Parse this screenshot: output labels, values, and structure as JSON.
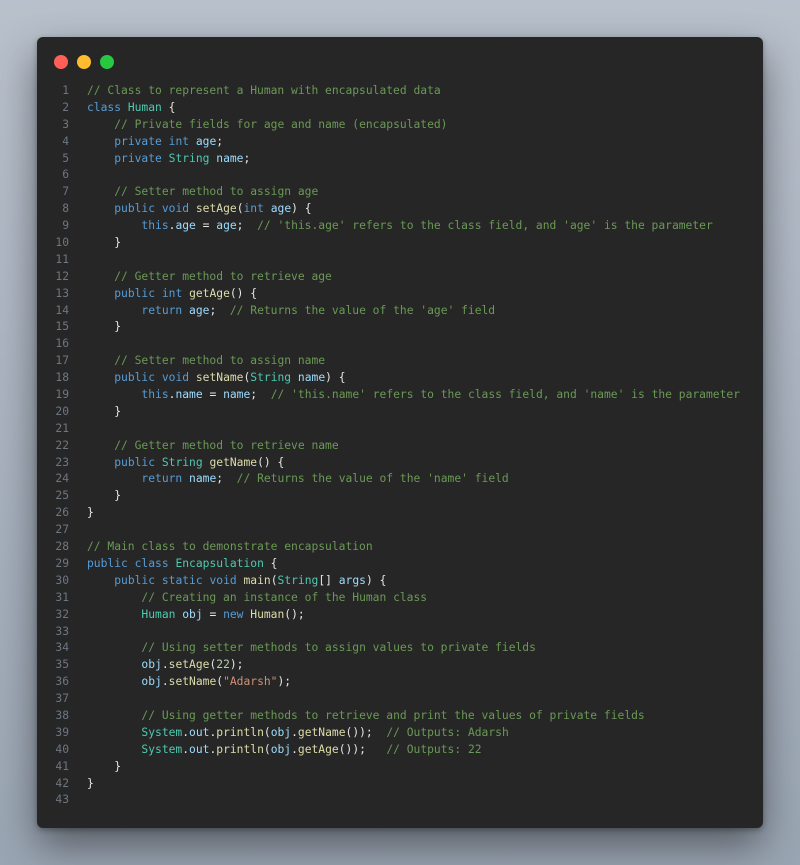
{
  "window": {
    "controls": {
      "close": "close-dot",
      "minimize": "minimize-dot",
      "maximize": "maximize-dot"
    }
  },
  "code": {
    "language": "java",
    "lines": [
      [
        [
          "c",
          "// Class to represent a Human with encapsulated data"
        ]
      ],
      [
        [
          "k",
          "class"
        ],
        [
          "p",
          " "
        ],
        [
          "t",
          "Human"
        ],
        [
          "p",
          " {"
        ]
      ],
      [
        [
          "p",
          "    "
        ],
        [
          "c",
          "// Private fields for age and name (encapsulated)"
        ]
      ],
      [
        [
          "p",
          "    "
        ],
        [
          "k",
          "private"
        ],
        [
          "p",
          " "
        ],
        [
          "k",
          "int"
        ],
        [
          "p",
          " "
        ],
        [
          "v",
          "age"
        ],
        [
          "p",
          ";"
        ]
      ],
      [
        [
          "p",
          "    "
        ],
        [
          "k",
          "private"
        ],
        [
          "p",
          " "
        ],
        [
          "t",
          "String"
        ],
        [
          "p",
          " "
        ],
        [
          "v",
          "name"
        ],
        [
          "p",
          ";"
        ]
      ],
      [],
      [
        [
          "p",
          "    "
        ],
        [
          "c",
          "// Setter method to assign age"
        ]
      ],
      [
        [
          "p",
          "    "
        ],
        [
          "k",
          "public"
        ],
        [
          "p",
          " "
        ],
        [
          "k",
          "void"
        ],
        [
          "p",
          " "
        ],
        [
          "f",
          "setAge"
        ],
        [
          "p",
          "("
        ],
        [
          "k",
          "int"
        ],
        [
          "p",
          " "
        ],
        [
          "v",
          "age"
        ],
        [
          "p",
          ") {"
        ]
      ],
      [
        [
          "p",
          "        "
        ],
        [
          "k",
          "this"
        ],
        [
          "p",
          "."
        ],
        [
          "v",
          "age"
        ],
        [
          "p",
          " = "
        ],
        [
          "v",
          "age"
        ],
        [
          "p",
          ";  "
        ],
        [
          "c",
          "// 'this.age' refers to the class field, and 'age' is the parameter"
        ]
      ],
      [
        [
          "p",
          "    }"
        ]
      ],
      [],
      [
        [
          "p",
          "    "
        ],
        [
          "c",
          "// Getter method to retrieve age"
        ]
      ],
      [
        [
          "p",
          "    "
        ],
        [
          "k",
          "public"
        ],
        [
          "p",
          " "
        ],
        [
          "k",
          "int"
        ],
        [
          "p",
          " "
        ],
        [
          "f",
          "getAge"
        ],
        [
          "p",
          "() {"
        ]
      ],
      [
        [
          "p",
          "        "
        ],
        [
          "k",
          "return"
        ],
        [
          "p",
          " "
        ],
        [
          "v",
          "age"
        ],
        [
          "p",
          ";  "
        ],
        [
          "c",
          "// Returns the value of the 'age' field"
        ]
      ],
      [
        [
          "p",
          "    }"
        ]
      ],
      [],
      [
        [
          "p",
          "    "
        ],
        [
          "c",
          "// Setter method to assign name"
        ]
      ],
      [
        [
          "p",
          "    "
        ],
        [
          "k",
          "public"
        ],
        [
          "p",
          " "
        ],
        [
          "k",
          "void"
        ],
        [
          "p",
          " "
        ],
        [
          "f",
          "setName"
        ],
        [
          "p",
          "("
        ],
        [
          "t",
          "String"
        ],
        [
          "p",
          " "
        ],
        [
          "v",
          "name"
        ],
        [
          "p",
          ") {"
        ]
      ],
      [
        [
          "p",
          "        "
        ],
        [
          "k",
          "this"
        ],
        [
          "p",
          "."
        ],
        [
          "v",
          "name"
        ],
        [
          "p",
          " = "
        ],
        [
          "v",
          "name"
        ],
        [
          "p",
          ";  "
        ],
        [
          "c",
          "// 'this.name' refers to the class field, and 'name' is the parameter"
        ]
      ],
      [
        [
          "p",
          "    }"
        ]
      ],
      [],
      [
        [
          "p",
          "    "
        ],
        [
          "c",
          "// Getter method to retrieve name"
        ]
      ],
      [
        [
          "p",
          "    "
        ],
        [
          "k",
          "public"
        ],
        [
          "p",
          " "
        ],
        [
          "t",
          "String"
        ],
        [
          "p",
          " "
        ],
        [
          "f",
          "getName"
        ],
        [
          "p",
          "() {"
        ]
      ],
      [
        [
          "p",
          "        "
        ],
        [
          "k",
          "return"
        ],
        [
          "p",
          " "
        ],
        [
          "v",
          "name"
        ],
        [
          "p",
          ";  "
        ],
        [
          "c",
          "// Returns the value of the 'name' field"
        ]
      ],
      [
        [
          "p",
          "    }"
        ]
      ],
      [
        [
          "p",
          "}"
        ]
      ],
      [],
      [
        [
          "c",
          "// Main class to demonstrate encapsulation"
        ]
      ],
      [
        [
          "k",
          "public"
        ],
        [
          "p",
          " "
        ],
        [
          "k",
          "class"
        ],
        [
          "p",
          " "
        ],
        [
          "t",
          "Encapsulation"
        ],
        [
          "p",
          " {"
        ]
      ],
      [
        [
          "p",
          "    "
        ],
        [
          "k",
          "public"
        ],
        [
          "p",
          " "
        ],
        [
          "k",
          "static"
        ],
        [
          "p",
          " "
        ],
        [
          "k",
          "void"
        ],
        [
          "p",
          " "
        ],
        [
          "f",
          "main"
        ],
        [
          "p",
          "("
        ],
        [
          "t",
          "String"
        ],
        [
          "p",
          "[] "
        ],
        [
          "v",
          "args"
        ],
        [
          "p",
          ") {"
        ]
      ],
      [
        [
          "p",
          "        "
        ],
        [
          "c",
          "// Creating an instance of the Human class"
        ]
      ],
      [
        [
          "p",
          "        "
        ],
        [
          "t",
          "Human"
        ],
        [
          "p",
          " "
        ],
        [
          "v",
          "obj"
        ],
        [
          "p",
          " = "
        ],
        [
          "k",
          "new"
        ],
        [
          "p",
          " "
        ],
        [
          "f",
          "Human"
        ],
        [
          "p",
          "();"
        ]
      ],
      [],
      [
        [
          "p",
          "        "
        ],
        [
          "c",
          "// Using setter methods to assign values to private fields"
        ]
      ],
      [
        [
          "p",
          "        "
        ],
        [
          "v",
          "obj"
        ],
        [
          "p",
          "."
        ],
        [
          "f",
          "setAge"
        ],
        [
          "p",
          "("
        ],
        [
          "n",
          "22"
        ],
        [
          "p",
          ");"
        ]
      ],
      [
        [
          "p",
          "        "
        ],
        [
          "v",
          "obj"
        ],
        [
          "p",
          "."
        ],
        [
          "f",
          "setName"
        ],
        [
          "p",
          "("
        ],
        [
          "s",
          "\"Adarsh\""
        ],
        [
          "p",
          ");"
        ]
      ],
      [],
      [
        [
          "p",
          "        "
        ],
        [
          "c",
          "// Using getter methods to retrieve and print the values of private fields"
        ]
      ],
      [
        [
          "p",
          "        "
        ],
        [
          "t",
          "System"
        ],
        [
          "p",
          "."
        ],
        [
          "v",
          "out"
        ],
        [
          "p",
          "."
        ],
        [
          "f",
          "println"
        ],
        [
          "p",
          "("
        ],
        [
          "v",
          "obj"
        ],
        [
          "p",
          "."
        ],
        [
          "f",
          "getName"
        ],
        [
          "p",
          "());  "
        ],
        [
          "c",
          "// Outputs: Adarsh"
        ]
      ],
      [
        [
          "p",
          "        "
        ],
        [
          "t",
          "System"
        ],
        [
          "p",
          "."
        ],
        [
          "v",
          "out"
        ],
        [
          "p",
          "."
        ],
        [
          "f",
          "println"
        ],
        [
          "p",
          "("
        ],
        [
          "v",
          "obj"
        ],
        [
          "p",
          "."
        ],
        [
          "f",
          "getAge"
        ],
        [
          "p",
          "());   "
        ],
        [
          "c",
          "// Outputs: 22"
        ]
      ],
      [
        [
          "p",
          "    }"
        ]
      ],
      [
        [
          "p",
          "}"
        ]
      ],
      []
    ]
  }
}
